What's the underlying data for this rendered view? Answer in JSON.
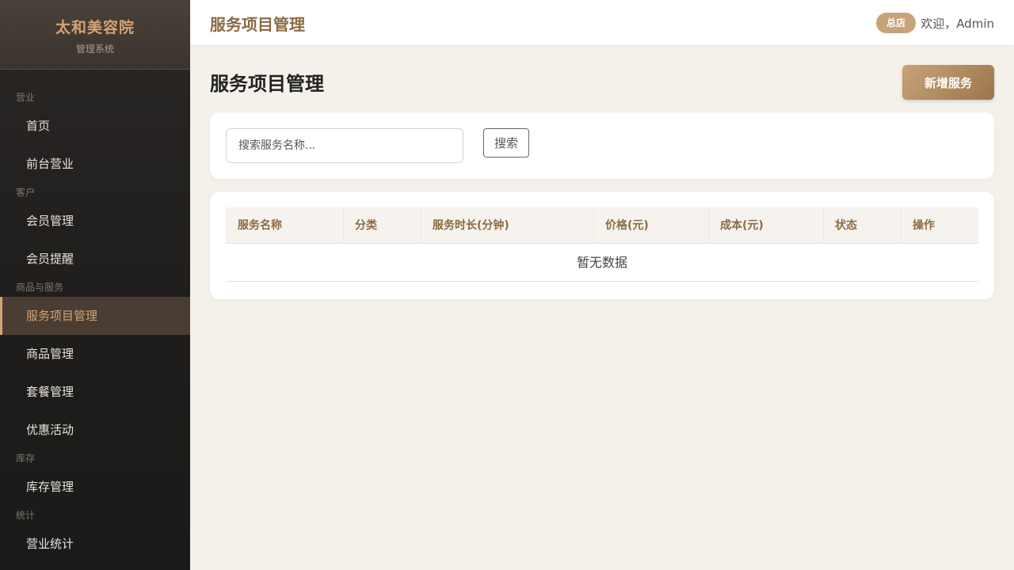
{
  "brand": {
    "title": "太和美容院",
    "subtitle": "管理系统"
  },
  "sidebar": {
    "groups": [
      {
        "label": "营业",
        "items": [
          "首页",
          "前台营业"
        ]
      },
      {
        "label": "客户",
        "items": [
          "会员管理",
          "会员提醒"
        ]
      },
      {
        "label": "商品与服务",
        "items": [
          "服务项目管理",
          "商品管理",
          "套餐管理",
          "优惠活动"
        ]
      },
      {
        "label": "库存",
        "items": [
          "库存管理"
        ]
      },
      {
        "label": "统计",
        "items": [
          "营业统计"
        ]
      }
    ],
    "active_item": "服务项目管理"
  },
  "header": {
    "title": "服务项目管理",
    "store_badge": "总店",
    "welcome": "欢迎，Admin"
  },
  "main": {
    "page_title": "服务项目管理",
    "add_button": "新增服务",
    "search": {
      "placeholder": "搜索服务名称...",
      "value": "",
      "button": "搜索"
    },
    "table": {
      "columns": [
        "服务名称",
        "分类",
        "服务时长(分钟)",
        "价格(元)",
        "成本(元)",
        "状态",
        "操作"
      ],
      "empty_text": "暂无数据"
    }
  },
  "colors": {
    "accent": "#d4a373",
    "brand_text": "#8b6a44",
    "sidebar_bg": "#1e1d1c",
    "page_bg": "#f4f1eb"
  }
}
